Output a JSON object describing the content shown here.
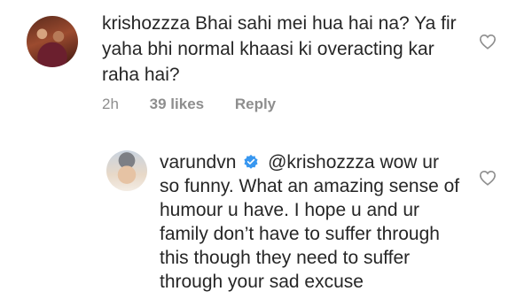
{
  "comment": {
    "username": "krishozzza",
    "text": "Bhai sahi mei hua hai na? Ya fir yaha bhi normal khaasi ki overacting kar raha hai?",
    "time": "2h",
    "likes": "39 likes",
    "reply_label": "Reply",
    "avatar_icon": "profile-photo",
    "like_icon": "heart-outline-icon"
  },
  "reply": {
    "username": "varundvn",
    "verified_icon": "verified-badge-icon",
    "verified_color": "#3897f0",
    "mention": "@krishozzza",
    "text": "wow ur so funny. What an amazing sense of humour u have. I hope u and ur family don’t have to suffer through this though they need to suffer through your sad excuse",
    "avatar_icon": "profile-photo",
    "like_icon": "heart-outline-icon"
  }
}
